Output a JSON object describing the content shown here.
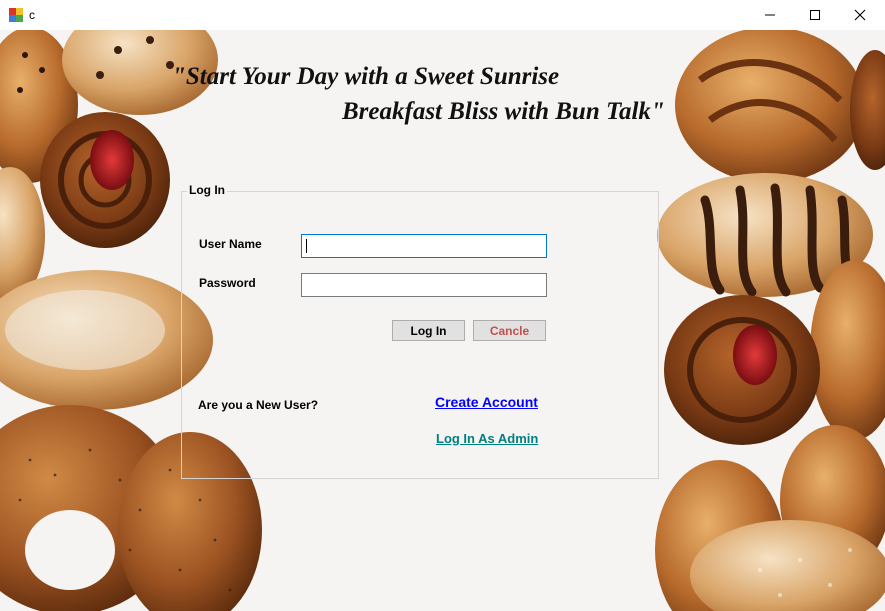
{
  "window": {
    "title": "c",
    "controls": {
      "minimize_icon": "minimize-icon",
      "maximize_icon": "maximize-icon",
      "close_icon": "close-icon"
    }
  },
  "slogan": {
    "line1": "\"Start Your Day with a Sweet Sunrise",
    "line2": "Breakfast Bliss with Bun Talk\""
  },
  "login_group": {
    "title": "Log In",
    "username_label": "User Name",
    "username_value": "",
    "password_label": "Password",
    "password_value": "",
    "login_button": "Log In",
    "cancel_button": "Cancle",
    "new_user_prompt": "Are you a New User?",
    "create_account_link": "Create Account",
    "admin_link": "Log In As Admin"
  },
  "colors": {
    "cancel_text": "#c0504d",
    "create_link": "#0000ff",
    "admin_link": "#008080",
    "focus_border": "#0078d7"
  }
}
